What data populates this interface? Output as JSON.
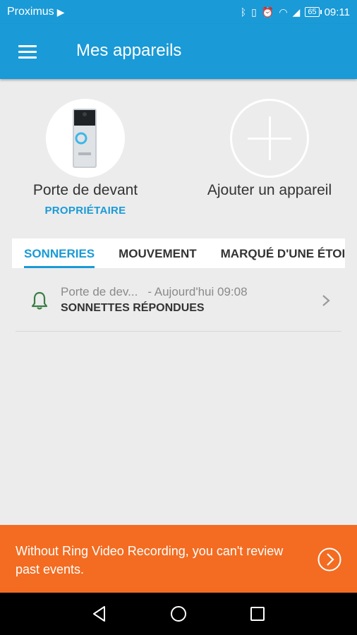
{
  "status_bar": {
    "carrier": "Proximus",
    "battery": "65",
    "time": "09:11"
  },
  "app_bar": {
    "title": "Mes appareils"
  },
  "devices": [
    {
      "name": "Porte de devant",
      "role": "PROPRIÉTAIRE"
    },
    {
      "name": "Ajouter un appareil"
    }
  ],
  "tabs": [
    {
      "label": "SONNERIES",
      "active": true
    },
    {
      "label": "MOUVEMENT"
    },
    {
      "label": "MARQUÉ D'UNE ÉTOILE"
    }
  ],
  "events": [
    {
      "device": "Porte de dev...",
      "time": "- Aujourd'hui 09:08",
      "type": "SONNETTES RÉPONDUES"
    }
  ],
  "banner": {
    "message": "Without Ring Video Recording, you can't review past events."
  },
  "colors": {
    "primary": "#1a9ad6",
    "banner": "#f36c21",
    "bell": "#3a7d44"
  }
}
